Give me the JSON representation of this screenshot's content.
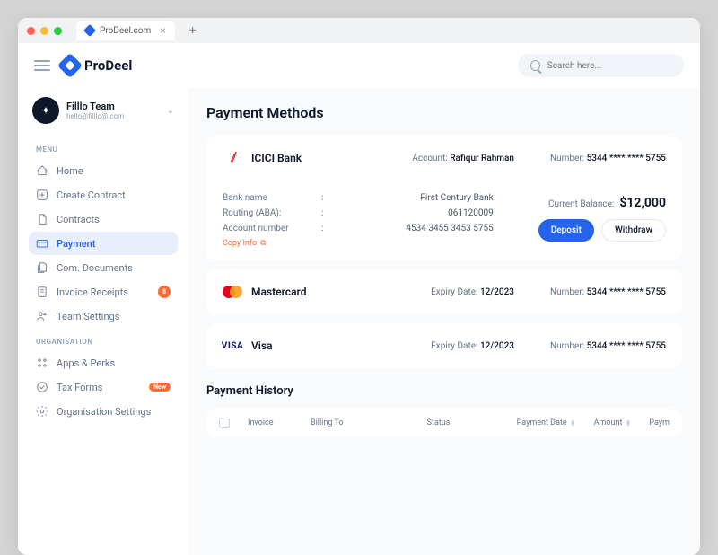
{
  "browser": {
    "tab_title": "ProDeel.com"
  },
  "app": {
    "name": "ProDeel"
  },
  "search": {
    "placeholder": "Search here..."
  },
  "team": {
    "name": "Filllo Team",
    "email": "hello@filllo@.com"
  },
  "sidebar": {
    "menu_label": "MENU",
    "org_label": "ORGANISATION",
    "items": {
      "home": "Home",
      "create_contract": "Create Contract",
      "contracts": "Contracts",
      "payment": "Payment",
      "com_documents": "Com. Documents",
      "invoice_receipts": "Invoice Receipts",
      "team_settings": "Team Settings",
      "apps_perks": "Apps & Perks",
      "tax_forms": "Tax Forms",
      "org_settings": "Organisation Settings"
    },
    "badges": {
      "invoice_count": "8",
      "tax_new": "New"
    }
  },
  "page": {
    "title": "Payment Methods",
    "history_title": "Payment History"
  },
  "methods": {
    "icici": {
      "name": "ICICI Bank",
      "account_label": "Account:",
      "account_holder": "Rafiqur Rahman",
      "number_label": "Number:",
      "number": "5344 **** **** 5755",
      "bank_name_label": "Bank name",
      "bank_name_val": "First Century Bank",
      "routing_label": "Routing (ABA):",
      "routing_val": "061120009",
      "acct_num_label": "Account number",
      "acct_num_val": "4534 3455 3453 5755",
      "copy": "Copy Info",
      "balance_label": "Current Balance:",
      "balance_val": "$12,000",
      "deposit": "Deposit",
      "withdraw": "Withdraw"
    },
    "mastercard": {
      "name": "Mastercard",
      "expiry_label": "Expiry Date:",
      "expiry_val": "12/2023",
      "number_label": "Number:",
      "number": "5344 **** **** 5755"
    },
    "visa": {
      "name": "Visa",
      "expiry_label": "Expiry Date:",
      "expiry_val": "12/2023",
      "number_label": "Number:",
      "number": "5344 **** **** 5755"
    }
  },
  "table": {
    "invoice": "Invoice",
    "billing_to": "Billing To",
    "status": "Status",
    "payment_date": "Payment Date",
    "amount": "Amount",
    "payment": "Paym"
  }
}
